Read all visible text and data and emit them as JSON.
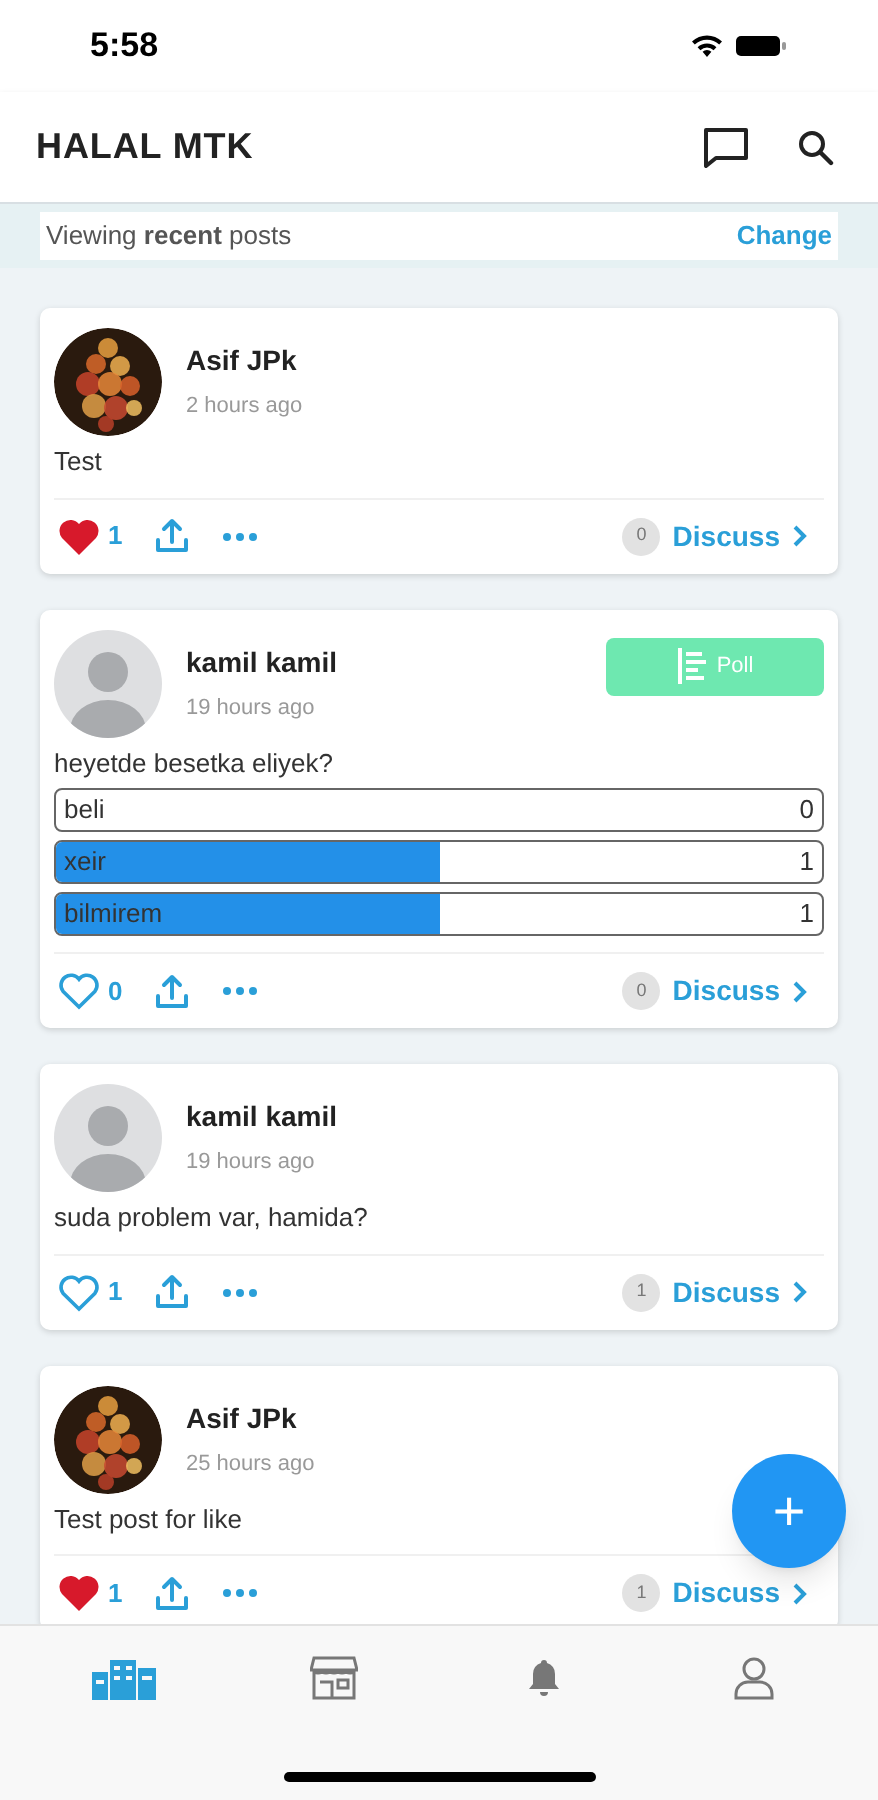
{
  "status_bar": {
    "time": "5:58"
  },
  "header": {
    "title": "HALAL MTK"
  },
  "filter_bar": {
    "text": "Viewing **recent** posts",
    "action": "Change"
  },
  "posts": [
    {
      "author": "Asif JPk",
      "time": "2 hours ago",
      "text": "Test",
      "liked": true,
      "likes": "1",
      "comments": "0",
      "action": "Discuss"
    },
    {
      "kind": "default",
      "author": "kamil kamil",
      "time": "19 hours ago",
      "badge": "Poll",
      "text": "heyetde besetka eliyek?",
      "poll": [
        {
          "label": "beli",
          "count": "0"
        },
        {
          "label": "xeir",
          "count": "1",
          "level": 0.5
        },
        {
          "label": "bilmirem",
          "count": "1",
          "level": 0.5
        }
      ],
      "liked": false,
      "likes": "0",
      "comments": "0",
      "action": "Discuss"
    },
    {
      "kind": "default",
      "author": "kamil kamil",
      "time": "19 hours ago",
      "text": "suda problem var, hamida?",
      "liked": false,
      "likes": "1",
      "comments": "1",
      "action": "Discuss"
    },
    {
      "author": "Asif JPk",
      "time": "25 hours ago",
      "text": "Test post for like",
      "liked": true,
      "likes": "1",
      "comments": "1",
      "action": "Discuss"
    }
  ],
  "fab": {
    "label": "+"
  },
  "tab_bar": [
    {
      "selected": true
    },
    {
      "selected": false
    },
    {
      "selected": false
    },
    {
      "selected": false
    }
  ]
}
